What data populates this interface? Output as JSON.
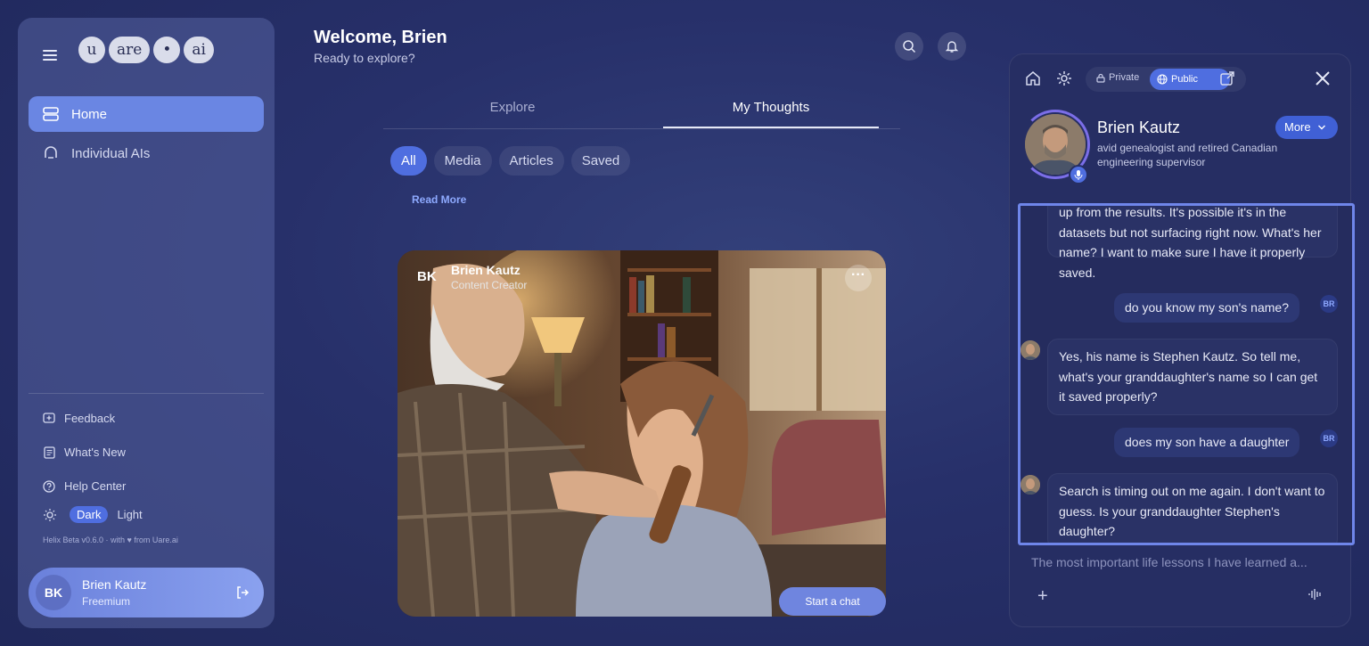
{
  "logo": [
    "u",
    "are",
    "•",
    "ai"
  ],
  "sidebar": {
    "items": [
      {
        "label": "Home",
        "icon": "home-icon"
      },
      {
        "label": "Individual AIs",
        "icon": "ai-icon"
      }
    ],
    "footer": [
      {
        "label": "Feedback",
        "icon": "feedback-icon"
      },
      {
        "label": "What's New",
        "icon": "news-icon"
      },
      {
        "label": "Help Center",
        "icon": "help-icon"
      }
    ],
    "theme": {
      "dark": "Dark",
      "light": "Light"
    },
    "version": "Helix Beta v0.6.0 · with ♥ from Uare.ai",
    "user": {
      "initials": "BK",
      "name": "Brien Kautz",
      "plan": "Freemium"
    }
  },
  "header": {
    "title": "Welcome, Brien",
    "subtitle": "Ready to explore?"
  },
  "tabs": [
    "Explore",
    "My Thoughts"
  ],
  "filters": [
    "All",
    "Media",
    "Articles",
    "Saved"
  ],
  "read_more": "Read More",
  "card": {
    "initials": "BK",
    "name": "Brien Kautz",
    "role": "Content Creator",
    "more": "···"
  },
  "start_chat": "Start a chat",
  "panel": {
    "private": "Private",
    "public": "Public",
    "name": "Brien Kautz",
    "description": "avid genealogist and retired Canadian engineering supervisor",
    "more": "More",
    "messages": [
      {
        "from": "bot",
        "text": "up from the results. It's possible it's in the datasets but not surfacing right now. What's her name? I want to make sure I have it properly saved."
      },
      {
        "from": "user",
        "text": "do you know my son's name?",
        "badge": "BR"
      },
      {
        "from": "bot",
        "text": "Yes, his name is Stephen Kautz. So tell me, what's your granddaughter's name so I can get it saved properly?"
      },
      {
        "from": "user",
        "text": "does my son have a daughter",
        "badge": "BR"
      },
      {
        "from": "bot",
        "text": "Search is timing out on me again. I don't want to guess. Is your granddaughter Stephen's daughter?"
      }
    ],
    "input_placeholder": "The most important life lessons I have learned a..."
  },
  "colors": {
    "accent": "#4f6ee0",
    "active_nav": "#6a86e3",
    "highlight_border": "#6f86ea"
  }
}
